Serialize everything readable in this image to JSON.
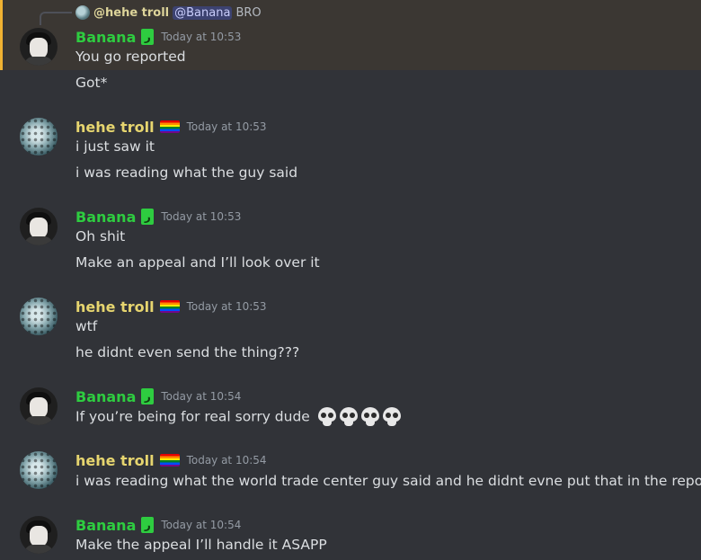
{
  "reply": {
    "author": "@hehe troll",
    "mention": "@Banana",
    "text": "BRO"
  },
  "messages": [
    {
      "author": "Banana",
      "role_badge": "ر",
      "time": "Today at 10:53",
      "lines": [
        "You go reported",
        "Got*"
      ]
    },
    {
      "author": "hehe troll",
      "time": "Today at 10:53",
      "lines": [
        "i just saw it",
        "i was reading what the guy said"
      ]
    },
    {
      "author": "Banana",
      "role_badge": "ر",
      "time": "Today at 10:53",
      "lines": [
        "Oh shit",
        "Make an appeal and I’ll look over it"
      ]
    },
    {
      "author": "hehe troll",
      "time": "Today at 10:53",
      "lines": [
        "wtf",
        "he didnt even send the thing???"
      ]
    },
    {
      "author": "Banana",
      "role_badge": "ر",
      "time": "Today at 10:54",
      "lines": [
        "If you’re being for real sorry dude"
      ]
    },
    {
      "author": "hehe troll",
      "time": "Today at 10:54",
      "lines": [
        "i was reading what the world trade center guy said and he didnt evne put that in the report..."
      ]
    },
    {
      "author": "Banana",
      "role_badge": "ر",
      "time": "Today at 10:54",
      "lines": [
        "Make the appeal I’ll handle it ASAPP"
      ]
    }
  ],
  "colors": {
    "background": "#313338",
    "highlight": "#3b3733",
    "highlight_border": "#f0b232",
    "banana_name": "#2ecc40",
    "troll_name": "#e6d56f",
    "timestamp": "#949ba4",
    "mention_bg": "#3c4270"
  },
  "icons": {
    "reply_avatar": "pufferfish-avatar-icon",
    "banana_badge": "role-badge-icon",
    "troll_badge": "rainbow-flag-icon",
    "emoji": "skull-emoji-icon"
  }
}
